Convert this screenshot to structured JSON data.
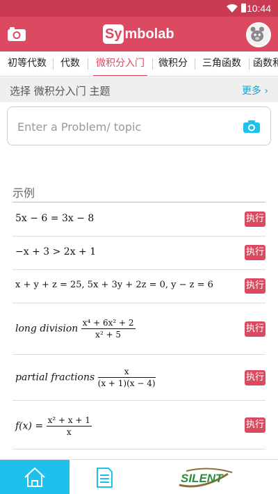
{
  "status": {
    "time": "10:44"
  },
  "header": {
    "logo_box": "Sy",
    "logo_rest": "mbolab"
  },
  "tabs": [
    {
      "label": "初等代数"
    },
    {
      "label": "代数"
    },
    {
      "label": "微积分入门"
    },
    {
      "label": "微积分"
    },
    {
      "label": "三角函数"
    },
    {
      "label": "函数和"
    }
  ],
  "topic": {
    "label": "选择 微积分入门 主题",
    "more": "更多"
  },
  "input": {
    "placeholder": "Enter a Problem/ topic"
  },
  "examples": {
    "title": "示例",
    "run_label": "执行",
    "items": [
      {
        "expr": "5x − 6 = 3x − 8"
      },
      {
        "expr": "−x + 3 > 2x + 1"
      },
      {
        "expr": "x + y + z = 25, 5x + 3y + 2z = 0, y − z = 6"
      },
      {
        "prefix": "long division",
        "num": "x⁴ + 6x² + 2",
        "den": "x² + 5"
      },
      {
        "prefix": "partial fractions",
        "num": "x",
        "den": "(x + 1)(x − 4)"
      },
      {
        "prefix": "f(x) =",
        "num": "x² + x + 1",
        "den": "x"
      }
    ]
  },
  "bottom_nav": {
    "brand": "SILENT"
  },
  "colors": {
    "brand": "#db4a60",
    "status_bar": "#c93b53",
    "accent": "#1ec1eb",
    "link": "#1da1c7"
  }
}
